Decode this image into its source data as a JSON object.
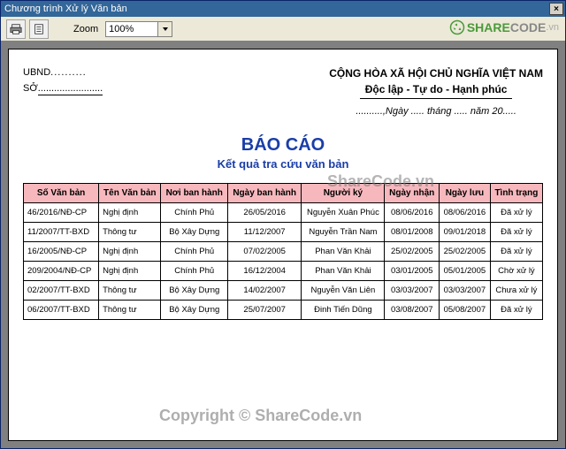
{
  "window": {
    "title": "Chương trình Xử lý Văn bản"
  },
  "toolbar": {
    "zoom_label": "Zoom",
    "zoom_value": "100%"
  },
  "doc": {
    "ubnd": "UBND",
    "so": "SỞ",
    "nation": "CỘNG HÒA XÃ HỘI CHỦ NGHĨA VIỆT NAM",
    "motto": "Độc lập - Tự do - Hạnh phúc",
    "date_line": "..........,Ngày ..... tháng ..... năm 20.....",
    "title": "BÁO CÁO",
    "subtitle": "Kết quả tra cứu văn bản"
  },
  "table": {
    "headers": [
      "Số Văn bản",
      "Tên Văn bản",
      "Nơi ban hành",
      "Ngày ban hành",
      "Người ký",
      "Ngày nhận",
      "Ngày lưu",
      "Tình trạng"
    ],
    "rows": [
      [
        "46/2016/NĐ-CP",
        "Nghị định",
        "Chính Phủ",
        "26/05/2016",
        "Nguyễn Xuân Phúc",
        "08/06/2016",
        "08/06/2016",
        "Đã xử lý"
      ],
      [
        "11/2007/TT-BXD",
        "Thông tư",
        "Bộ Xây Dựng",
        "11/12/2007",
        "Nguyễn Trần Nam",
        "08/01/2008",
        "09/01/2018",
        "Đã xử lý"
      ],
      [
        "16/2005/NĐ-CP",
        "Nghị định",
        "Chính Phủ",
        "07/02/2005",
        "Phan Văn Khải",
        "25/02/2005",
        "25/02/2005",
        "Đã xử lý"
      ],
      [
        "209/2004/NĐ-CP",
        "Nghị định",
        "Chính Phủ",
        "16/12/2004",
        "Phan Văn Khải",
        "03/01/2005",
        "05/01/2005",
        "Chờ xử lý"
      ],
      [
        "02/2007/TT-BXD",
        "Thông tư",
        "Bộ Xây Dựng",
        "14/02/2007",
        "Nguyễn Văn Liên",
        "03/03/2007",
        "03/03/2007",
        "Chưa xử lý"
      ],
      [
        "06/2007/TT-BXD",
        "Thông tư",
        "Bộ Xây Dựng",
        "25/07/2007",
        "Đinh Tiến Dũng",
        "03/08/2007",
        "05/08/2007",
        "Đã xử lý"
      ]
    ]
  },
  "watermark": {
    "brand1": "SHARE",
    "brand2": "CODE",
    "brand3": ".vn",
    "mid": "ShareCode.vn",
    "bottom": "Copyright © ShareCode.vn"
  }
}
